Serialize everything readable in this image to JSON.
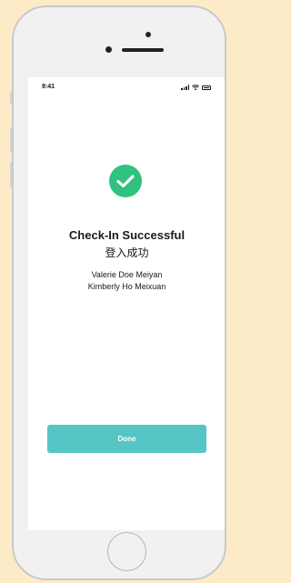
{
  "status_bar": {
    "time": "9:41",
    "icons": [
      "signal-icon",
      "wifi-icon",
      "battery-icon"
    ]
  },
  "status_icon": "checkmark-circle-icon",
  "accent_color": "#2ec27e",
  "button_color": "#56c5c6",
  "title": "Check-In Successful",
  "subtitle": "登入成功",
  "names": [
    "Valerie Doe Meiyan",
    "Kimberly Ho Meixuan"
  ],
  "done_button": {
    "label": "Done"
  }
}
